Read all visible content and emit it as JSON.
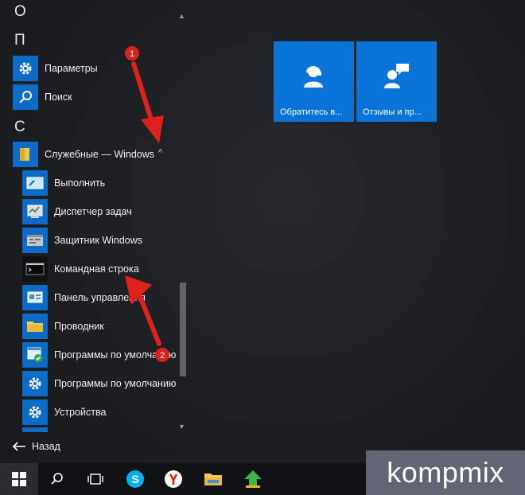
{
  "start_menu": {
    "letters": [
      "О",
      "П",
      "С"
    ],
    "apps": [
      {
        "label": "Параметры",
        "icon": "gear-icon"
      },
      {
        "label": "Поиск",
        "icon": "search-icon"
      },
      {
        "label": "Служебные — Windows",
        "icon": "folder-icon"
      }
    ],
    "subitems": [
      {
        "label": "Выполнить",
        "icon": "run-icon"
      },
      {
        "label": "Диспетчер задач",
        "icon": "task-manager-icon"
      },
      {
        "label": "Защитник Windows",
        "icon": "defender-icon"
      },
      {
        "label": "Командная строка",
        "icon": "terminal-icon"
      },
      {
        "label": "Панель управления",
        "icon": "control-panel-icon"
      },
      {
        "label": "Проводник",
        "icon": "folder-icon"
      },
      {
        "label": "Программы по умолчанию",
        "icon": "default-programs-icon"
      },
      {
        "label": "Программы по умолчанию",
        "icon": "gear-icon"
      },
      {
        "label": "Устройства",
        "icon": "gear-icon"
      }
    ],
    "back_label": "Назад"
  },
  "tiles": [
    {
      "label": "Обратитесь в...",
      "icon": "support-agent-icon"
    },
    {
      "label": "Отзывы и пр...",
      "icon": "feedback-icon"
    }
  ],
  "annotations": {
    "marker1": "1",
    "marker2": "2"
  },
  "taskbar": {
    "items": [
      "start-icon",
      "search-icon",
      "task-view-icon",
      "skype-icon",
      "yandex-browser-icon",
      "file-explorer-icon",
      "download-icon"
    ]
  },
  "watermark": "kompmix",
  "colors": {
    "accent": "#0a6cc6",
    "tile": "#0a74d6",
    "arrow": "#e0201b",
    "taskbar": "#101113"
  }
}
